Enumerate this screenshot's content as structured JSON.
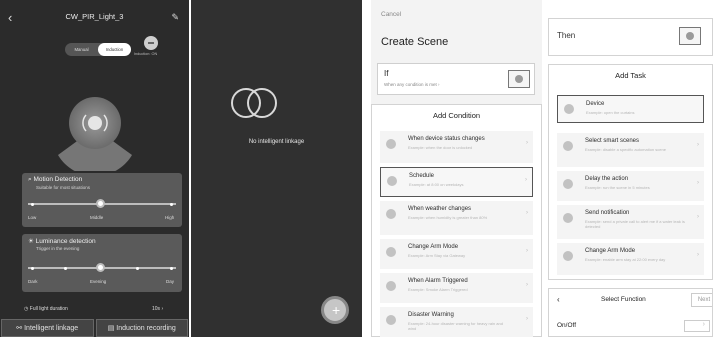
{
  "panel1": {
    "title": "CW_PIR_Light_3",
    "modes": [
      "Manual",
      "Induction"
    ],
    "active_mode": "Induction",
    "induction_status": "Induction: ON",
    "motion": {
      "title": "Motion Detection",
      "subtitle": "Suitable for most situations",
      "labels": [
        "Low",
        "Middle",
        "High"
      ],
      "level": "Middle"
    },
    "luminance": {
      "title": "Luminance detection",
      "subtitle": "Trigger in the evening",
      "labels": [
        "Dark",
        "Evening",
        "Day"
      ],
      "level": "Evening"
    },
    "duration_label": "Full light duration",
    "duration_value": "10s",
    "tabs": [
      "Intelligent linkage",
      "Induction recording"
    ]
  },
  "panel2": {
    "empty_message": "No intelligent linkage"
  },
  "panel3": {
    "cancel": "Cancel",
    "title": "Create Scene",
    "if_title": "If",
    "if_subtitle": "When any condition is met",
    "add_condition": "Add Condition",
    "conditions": [
      {
        "title": "When device status changes",
        "sub": "Example: when the door is unlocked"
      },
      {
        "title": "Schedule",
        "sub": "Example: at 8:00 on weekdays"
      },
      {
        "title": "When weather changes",
        "sub": "Example: when humidity is greater than 80%"
      },
      {
        "title": "Change Arm Mode",
        "sub": "Example: Arm Stay via Gateway"
      },
      {
        "title": "When Alarm Triggered",
        "sub": "Example: Smoke Alarm Triggered"
      },
      {
        "title": "Disaster Warning",
        "sub": "Example: 24-hour disaster warning for heavy rain and wind"
      }
    ]
  },
  "panel4": {
    "then": "Then",
    "add_task": "Add Task",
    "tasks": [
      {
        "title": "Device",
        "sub": "Example: open the curtains"
      },
      {
        "title": "Select smart scenes",
        "sub": "Example: disable a specific automation scene"
      },
      {
        "title": "Delay the action",
        "sub": "Example: run the scene in 5 minutes"
      },
      {
        "title": "Send notification",
        "sub": "Example: send a private call to alert me if a water leak is detected"
      },
      {
        "title": "Change Arm Mode",
        "sub": "Example: enable arm stay at 22:00 every day"
      }
    ],
    "select_function": "Select Function",
    "next": "Next",
    "on_off": "On/Off"
  },
  "icons": {
    "back": "chevron-left-icon",
    "edit": "pencil-icon",
    "sensor": "radar-icon",
    "empty": "rings-icon",
    "add": "plus-icon"
  }
}
